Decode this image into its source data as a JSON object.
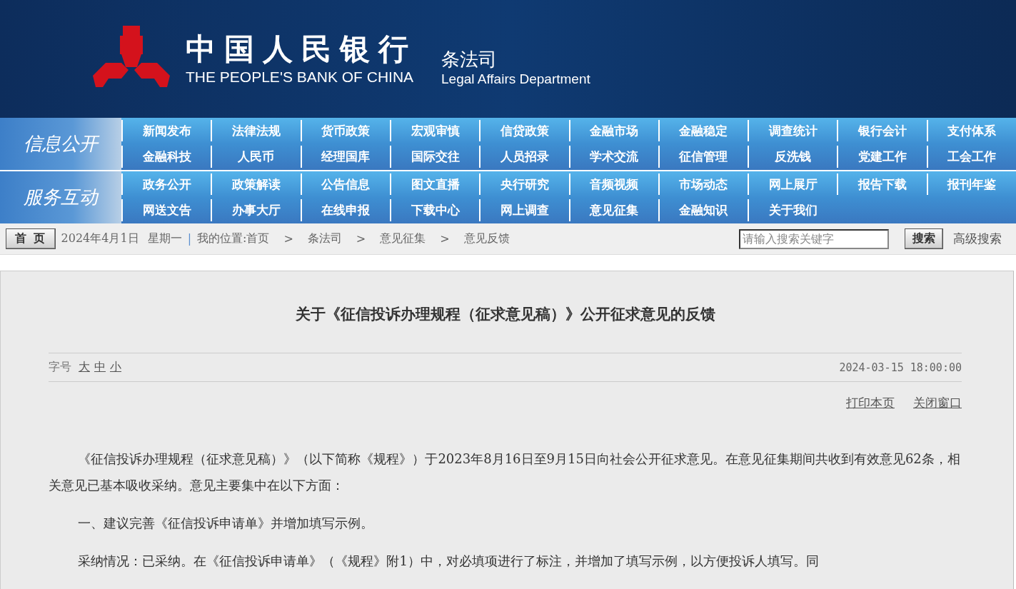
{
  "header": {
    "title": "中国人民银行",
    "title_en": "THE PEOPLE'S BANK OF CHINA",
    "department": "条法司",
    "department_en": "Legal Affairs Department"
  },
  "nav_sections": [
    {
      "label": "信息公开",
      "items": [
        "新闻发布",
        "法律法规",
        "货币政策",
        "宏观审慎",
        "信贷政策",
        "金融市场",
        "金融稳定",
        "调查统计",
        "银行会计",
        "支付体系",
        "金融科技",
        "人民币",
        "经理国库",
        "国际交往",
        "人员招录",
        "学术交流",
        "征信管理",
        "反洗钱",
        "党建工作",
        "工会工作"
      ]
    },
    {
      "label": "服务互动",
      "items": [
        "政务公开",
        "政策解读",
        "公告信息",
        "图文直播",
        "央行研究",
        "音频视频",
        "市场动态",
        "网上展厅",
        "报告下载",
        "报刊年鉴",
        "网送文告",
        "办事大厅",
        "在线申报",
        "下载中心",
        "网上调查",
        "意见征集",
        "金融知识",
        "关于我们"
      ]
    }
  ],
  "breadcrumb": {
    "home_button": "首 页",
    "date": "2024年4月1日",
    "weekday": "星期一",
    "divider": "|",
    "location": "我的位置:首页",
    "separator": ">",
    "crumbs": [
      "条法司",
      "意见征集",
      "意见反馈"
    ]
  },
  "search": {
    "placeholder": "请输入搜索关键字",
    "button": "搜索",
    "advanced": "高级搜索"
  },
  "article": {
    "title": "关于《征信投诉办理规程（征求意见稿）》公开征求意见的反馈",
    "font_size_label": "字号",
    "font_sizes": [
      "大",
      "中",
      "小"
    ],
    "datetime": "2024-03-15 18:00:00",
    "actions": [
      "打印本页",
      "关闭窗口"
    ],
    "paragraphs": [
      "《征信投诉办理规程（征求意见稿）》（以下简称《规程》）于2023年8月16日至9月15日向社会公开征求意见。在意见征集期间共收到有效意见62条，相关意见已基本吸收采纳。意见主要集中在以下方面：",
      "一、建议完善《征信投诉申请单》并增加填写示例。",
      "采纳情况：已采纳。在《征信投诉申请单》（《规程》附1）中，对必填项进行了标注，并增加了填写示例，以方便投诉人填写。同"
    ]
  }
}
